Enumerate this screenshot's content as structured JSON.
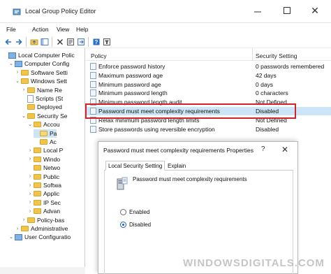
{
  "window": {
    "title": "Local Group Policy Editor"
  },
  "menu": [
    "File",
    "Action",
    "View",
    "Help"
  ],
  "toolbar_icons": [
    "back-arrow-icon",
    "forward-arrow-icon",
    "folder-up-icon",
    "show-hide-tree-icon",
    "delete-icon",
    "properties-icon",
    "export-list-icon",
    "help-icon",
    "filter-icon"
  ],
  "tree": [
    {
      "label": "Local Computer Polic",
      "level": 0,
      "twisty": "",
      "icon": "pc"
    },
    {
      "label": "Computer Config",
      "level": 1,
      "twisty": "v",
      "icon": "pc"
    },
    {
      "label": "Software Setti",
      "level": 2,
      "twisty": ">",
      "icon": "folder"
    },
    {
      "label": "Windows Sett",
      "level": 2,
      "twisty": "v",
      "icon": "folder"
    },
    {
      "label": "Name Re",
      "level": 3,
      "twisty": ">",
      "icon": "folder"
    },
    {
      "label": "Scripts (St",
      "level": 3,
      "twisty": "",
      "icon": "doc"
    },
    {
      "label": "Deployed",
      "level": 3,
      "twisty": "",
      "icon": "folder"
    },
    {
      "label": "Security Se",
      "level": 3,
      "twisty": "v",
      "icon": "folder"
    },
    {
      "label": "Accou",
      "level": 4,
      "twisty": "v",
      "icon": "folder"
    },
    {
      "label": "Pa",
      "level": 5,
      "twisty": "",
      "icon": "folder-open",
      "selected": true
    },
    {
      "label": "Ac",
      "level": 5,
      "twisty": "",
      "icon": "folder"
    },
    {
      "label": "Local P",
      "level": 4,
      "twisty": ">",
      "icon": "folder"
    },
    {
      "label": "Windo",
      "level": 4,
      "twisty": ">",
      "icon": "folder"
    },
    {
      "label": "Netwo",
      "level": 4,
      "twisty": "",
      "icon": "folder"
    },
    {
      "label": "Public",
      "level": 4,
      "twisty": ">",
      "icon": "folder"
    },
    {
      "label": "Softwa",
      "level": 4,
      "twisty": ">",
      "icon": "folder"
    },
    {
      "label": "Applic",
      "level": 4,
      "twisty": ">",
      "icon": "folder"
    },
    {
      "label": "IP Sec",
      "level": 4,
      "twisty": ">",
      "icon": "folder"
    },
    {
      "label": "Advan",
      "level": 4,
      "twisty": ">",
      "icon": "folder"
    },
    {
      "label": "Policy-bas",
      "level": 3,
      "twisty": ">",
      "icon": "folder"
    },
    {
      "label": "Administrative",
      "level": 2,
      "twisty": ">",
      "icon": "folder"
    },
    {
      "label": "User Configuratio",
      "level": 1,
      "twisty": "v",
      "icon": "pc"
    }
  ],
  "list": {
    "headers": {
      "policy": "Policy",
      "setting": "Security Setting"
    },
    "rows": [
      {
        "policy": "Enforce password history",
        "setting": "0 passwords remembered"
      },
      {
        "policy": "Maximum password age",
        "setting": "42 days"
      },
      {
        "policy": "Minimum password age",
        "setting": "0 days"
      },
      {
        "policy": "Minimum password length",
        "setting": "0 characters"
      },
      {
        "policy": "Minimum password length audit",
        "setting": "Not Defined"
      },
      {
        "policy": "Password must meet complexity requirements",
        "setting": "Disabled",
        "selected": true
      },
      {
        "policy": "Relax minimum password length limits",
        "setting": "Not Defined"
      },
      {
        "policy": "Store passwords using reversible encryption",
        "setting": "Disabled"
      }
    ]
  },
  "dialog": {
    "title": "Password must meet complexity requirements Properties",
    "help": "?",
    "close": "✕",
    "tabs": [
      "Local Security Setting",
      "Explain"
    ],
    "heading": "Password must meet complexity requirements",
    "options": [
      {
        "label": "Enabled",
        "checked": false
      },
      {
        "label": "Disabled",
        "checked": true
      }
    ]
  },
  "watermark": "WINDOWSDIGITALS.COM",
  "colors": {
    "selection": "#cde6f7",
    "highlight": "#d4222a",
    "accent": "#1f5fbf"
  }
}
